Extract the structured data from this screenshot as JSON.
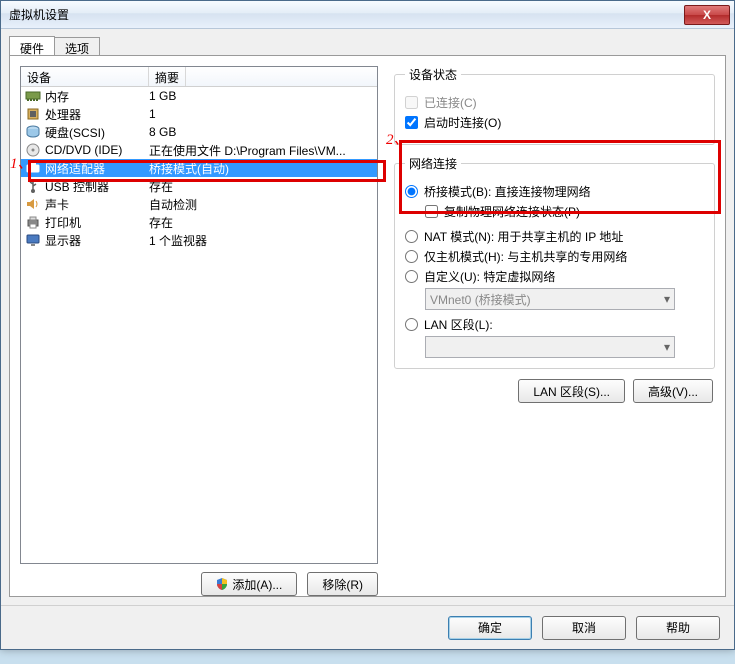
{
  "window": {
    "title": "虚拟机设置",
    "close": "X"
  },
  "tabs": {
    "hw": "硬件",
    "opt": "选项"
  },
  "columns": {
    "device": "设备",
    "summary": "摘要"
  },
  "devices": [
    {
      "icon": "memory",
      "name": "内存",
      "summary": "1 GB"
    },
    {
      "icon": "cpu",
      "name": "处理器",
      "summary": "1"
    },
    {
      "icon": "disk",
      "name": "硬盘(SCSI)",
      "summary": "8 GB"
    },
    {
      "icon": "cd",
      "name": "CD/DVD (IDE)",
      "summary": "正在使用文件 D:\\Program Files\\VM..."
    },
    {
      "icon": "net",
      "name": "网络适配器",
      "summary": "桥接模式(自动)"
    },
    {
      "icon": "usb",
      "name": "USB 控制器",
      "summary": "存在"
    },
    {
      "icon": "sound",
      "name": "声卡",
      "summary": "自动检测"
    },
    {
      "icon": "printer",
      "name": "打印机",
      "summary": "存在"
    },
    {
      "icon": "display",
      "name": "显示器",
      "summary": "1 个监视器"
    }
  ],
  "selectedIndex": 4,
  "leftButtons": {
    "add": "添加(A)...",
    "remove": "移除(R)"
  },
  "status": {
    "legend": "设备状态",
    "connected": "已连接(C)",
    "connectAtPower": "启动时连接(O)"
  },
  "net": {
    "legend": "网络连接",
    "bridged": "桥接模式(B): 直接连接物理网络",
    "replicate": "复制物理网络连接状态(P)",
    "nat": "NAT 模式(N): 用于共享主机的 IP 地址",
    "hostonly": "仅主机模式(H): 与主机共享的专用网络",
    "custom": "自定义(U): 特定虚拟网络",
    "customCombo": "VMnet0 (桥接模式)",
    "lanseg": "LAN 区段(L):",
    "lanCombo": ""
  },
  "rightButtons": {
    "lan": "LAN 区段(S)...",
    "adv": "高级(V)..."
  },
  "footer": {
    "ok": "确定",
    "cancel": "取消",
    "help": "帮助"
  },
  "annotations": {
    "one": "1、",
    "two": "2、"
  }
}
